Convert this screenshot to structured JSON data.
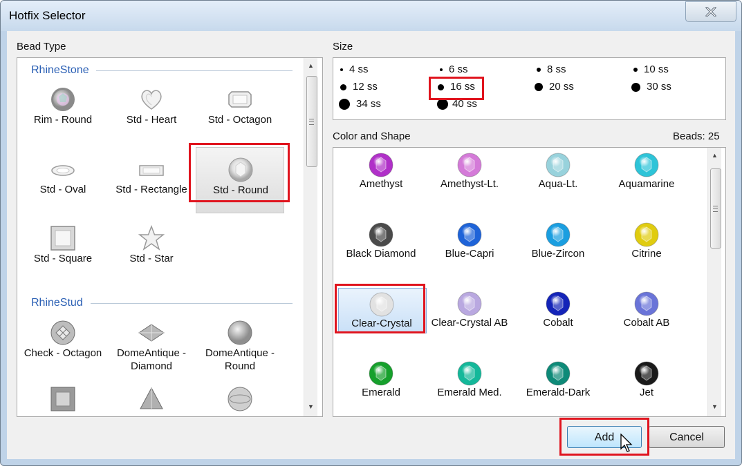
{
  "window": {
    "title": "Hotfix Selector"
  },
  "bead_type": {
    "label": "Bead Type",
    "sections": [
      {
        "title": "RhineStone",
        "items": [
          {
            "label": "Rim - Round",
            "icon": "rim-round-icon"
          },
          {
            "label": "Std - Heart",
            "icon": "heart-icon"
          },
          {
            "label": "Std - Octagon",
            "icon": "octagon-icon"
          },
          {
            "label": "Std - Oval",
            "icon": "oval-icon"
          },
          {
            "label": "Std - Rectangle",
            "icon": "rectangle-icon"
          },
          {
            "label": "Std - Round",
            "icon": "round-icon",
            "selected": true
          },
          {
            "label": "Std - Square",
            "icon": "square-icon"
          },
          {
            "label": "Std - Star",
            "icon": "star-icon"
          }
        ]
      },
      {
        "title": "RhineStud",
        "items": [
          {
            "label": "Check - Octagon",
            "icon": "check-octagon-icon"
          },
          {
            "label": "DomeAntique - Diamond",
            "icon": "dome-diamond-icon"
          },
          {
            "label": "DomeAntique - Round",
            "icon": "dome-round-icon"
          }
        ]
      }
    ]
  },
  "size": {
    "label": "Size",
    "options": [
      "4 ss",
      "6 ss",
      "8 ss",
      "10 ss",
      "12 ss",
      "16 ss",
      "20 ss",
      "30 ss",
      "34 ss",
      "40 ss"
    ],
    "selected": "16 ss"
  },
  "color_shape": {
    "label": "Color and Shape",
    "beads_count": "Beads: 25",
    "items": [
      {
        "label": "Amethyst",
        "color": "#b030c8"
      },
      {
        "label": "Amethyst-Lt.",
        "color": "#d47ad8"
      },
      {
        "label": "Aqua-Lt.",
        "color": "#98d2dc"
      },
      {
        "label": "Aquamarine",
        "color": "#2ec4d8"
      },
      {
        "label": "Black Diamond",
        "color": "#4a4a4a"
      },
      {
        "label": "Blue-Capri",
        "color": "#1e63d8"
      },
      {
        "label": "Blue-Zircon",
        "color": "#1a9ee0"
      },
      {
        "label": "Citrine",
        "color": "#e0cc10"
      },
      {
        "label": "Clear-Crystal",
        "color": "#e2e2e2",
        "selected": true
      },
      {
        "label": "Clear-Crystal AB",
        "color": "#b9a8e0"
      },
      {
        "label": "Cobalt",
        "color": "#1424b8"
      },
      {
        "label": "Cobalt AB",
        "color": "#6a74d8"
      },
      {
        "label": "Emerald",
        "color": "#16a02c"
      },
      {
        "label": "Emerald Med.",
        "color": "#14b89a"
      },
      {
        "label": "Emerald-Dark",
        "color": "#0e8a78"
      },
      {
        "label": "Jet",
        "color": "#1a1a1a"
      }
    ]
  },
  "buttons": {
    "add": "Add",
    "cancel": "Cancel"
  }
}
